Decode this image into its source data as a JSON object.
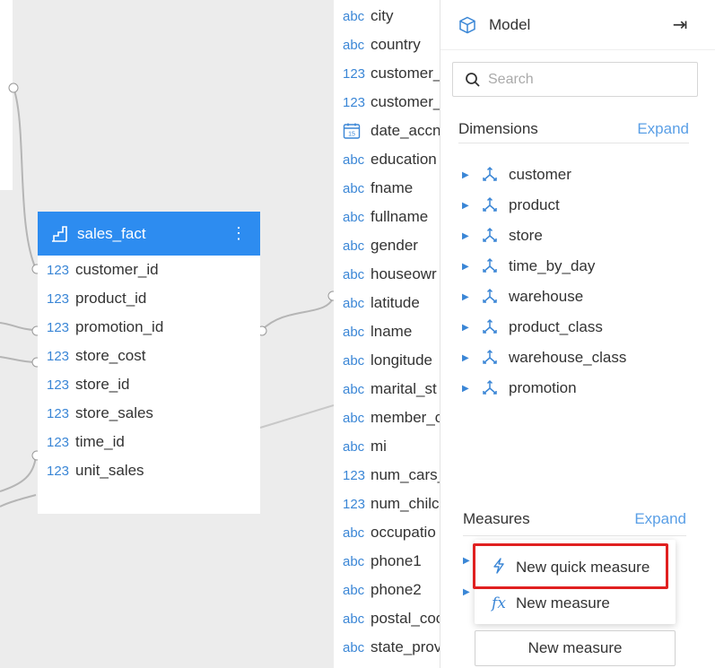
{
  "fact_table": {
    "title": "sales_fact",
    "columns": [
      {
        "type": "123",
        "name": "customer_id"
      },
      {
        "type": "123",
        "name": "product_id"
      },
      {
        "type": "123",
        "name": "promotion_id"
      },
      {
        "type": "123",
        "name": "store_cost"
      },
      {
        "type": "123",
        "name": "store_id"
      },
      {
        "type": "123",
        "name": "store_sales"
      },
      {
        "type": "123",
        "name": "time_id"
      },
      {
        "type": "123",
        "name": "unit_sales"
      }
    ]
  },
  "columns_list": [
    {
      "type": "abc",
      "name": "city"
    },
    {
      "type": "abc",
      "name": "country"
    },
    {
      "type": "123",
      "name": "customer_"
    },
    {
      "type": "123",
      "name": "customer_"
    },
    {
      "type": "date",
      "name": "date_accn"
    },
    {
      "type": "abc",
      "name": "education"
    },
    {
      "type": "abc",
      "name": "fname"
    },
    {
      "type": "abc",
      "name": "fullname"
    },
    {
      "type": "abc",
      "name": "gender"
    },
    {
      "type": "abc",
      "name": "houseowr"
    },
    {
      "type": "abc",
      "name": "latitude"
    },
    {
      "type": "abc",
      "name": "lname"
    },
    {
      "type": "abc",
      "name": "longitude"
    },
    {
      "type": "abc",
      "name": "marital_st"
    },
    {
      "type": "abc",
      "name": "member_c"
    },
    {
      "type": "abc",
      "name": "mi"
    },
    {
      "type": "123",
      "name": "num_cars_"
    },
    {
      "type": "123",
      "name": "num_chilc"
    },
    {
      "type": "abc",
      "name": "occupatio"
    },
    {
      "type": "abc",
      "name": "phone1"
    },
    {
      "type": "abc",
      "name": "phone2"
    },
    {
      "type": "abc",
      "name": "postal_coc"
    },
    {
      "type": "abc",
      "name": "state_prov"
    }
  ],
  "model": {
    "title": "Model",
    "collapse_icon": "panel-collapse-icon",
    "search_placeholder": "Search",
    "dimensions_label": "Dimensions",
    "dimensions_expand": "Expand",
    "dimensions": [
      "customer",
      "product",
      "store",
      "time_by_day",
      "warehouse",
      "product_class",
      "warehouse_class",
      "promotion"
    ],
    "measures_label": "Measures",
    "measures_expand": "Expand",
    "menu": {
      "quick_measure": "New quick measure",
      "new_measure": "New measure"
    },
    "new_measure_button": "New measure"
  },
  "colors": {
    "accent": "#2d8cf0",
    "link": "#5a9fe6",
    "highlight": "#e02020"
  }
}
